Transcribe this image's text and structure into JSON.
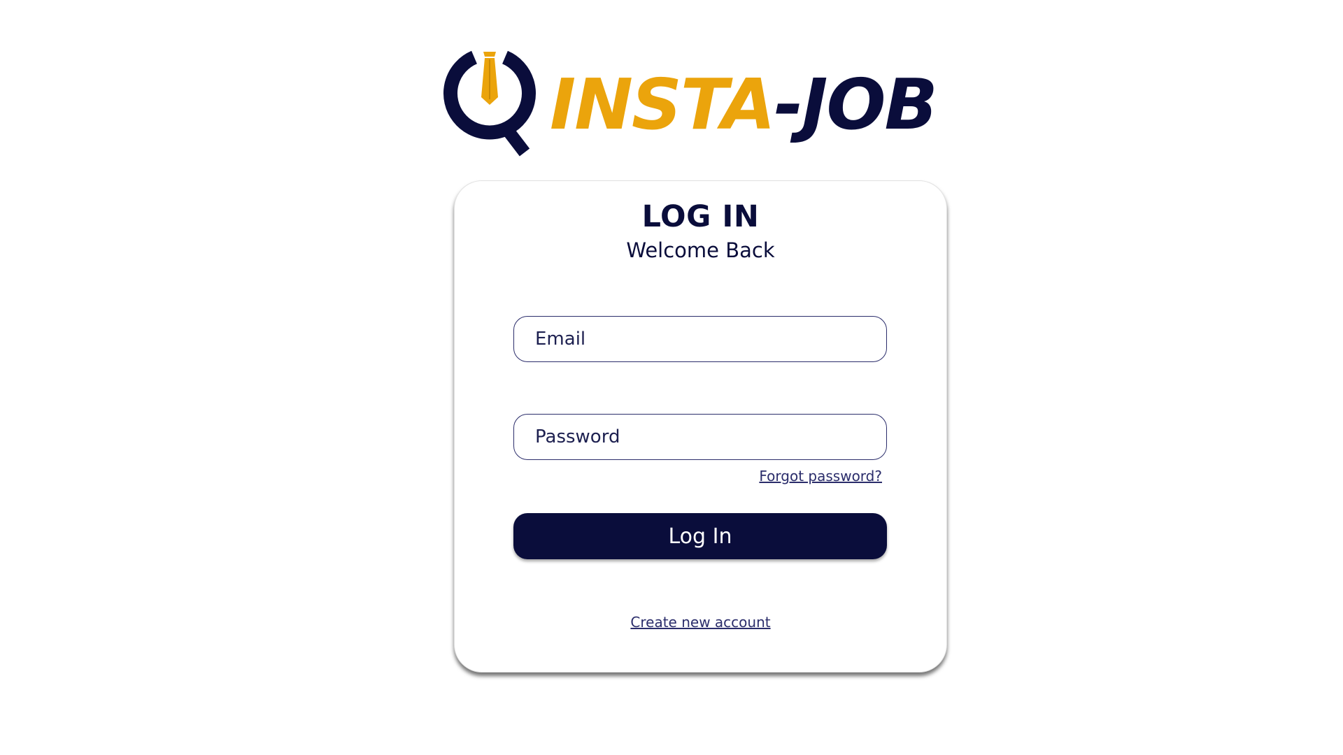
{
  "brand": {
    "name_part1": "INSTA",
    "name_part2": "-JOB",
    "colors": {
      "gold": "#eba40c",
      "navy": "#0a0d3b"
    },
    "icon": "magnifier-with-tie-icon"
  },
  "login_card": {
    "title": "LOG IN",
    "subtitle": "Welcome Back",
    "email_placeholder": "Email",
    "password_placeholder": "Password",
    "forgot_password_label": "Forgot password?",
    "login_button_label": "Log In",
    "create_account_label": "Create new account"
  }
}
